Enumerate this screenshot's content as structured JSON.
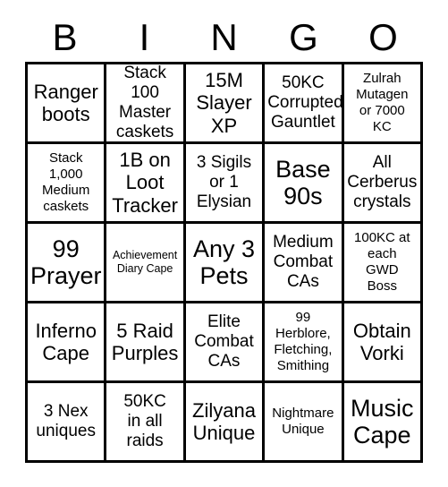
{
  "card": {
    "title_letters": [
      "B",
      "I",
      "N",
      "G",
      "O"
    ],
    "columns": 5,
    "rows": 5,
    "grid_line_color": "#000000",
    "background_color": "#ffffff",
    "text_color": "#000000",
    "cells": [
      {
        "text": "Ranger\nboots",
        "size": "lg"
      },
      {
        "text": "Stack 100\nMaster\ncaskets",
        "size": "md"
      },
      {
        "text": "15M\nSlayer\nXP",
        "size": "lg"
      },
      {
        "text": "50KC\nCorrupted\nGauntlet",
        "size": "md"
      },
      {
        "text": "Zulrah\nMutagen\nor 7000\nKC",
        "size": "sm"
      },
      {
        "text": "Stack\n1,000\nMedium\ncaskets",
        "size": "sm"
      },
      {
        "text": "1B on\nLoot\nTracker",
        "size": "lg"
      },
      {
        "text": "3 Sigils\nor 1\nElysian",
        "size": "md"
      },
      {
        "text": "Base\n90s",
        "size": "xl"
      },
      {
        "text": "All\nCerberus\ncrystals",
        "size": "md"
      },
      {
        "text": "99\nPrayer",
        "size": "xl"
      },
      {
        "text": "Achievement\nDiary Cape",
        "size": "xs"
      },
      {
        "text": "Any 3\nPets",
        "size": "xl"
      },
      {
        "text": "Medium\nCombat\nCAs",
        "size": "md"
      },
      {
        "text": "100KC at\neach\nGWD\nBoss",
        "size": "sm"
      },
      {
        "text": "Inferno\nCape",
        "size": "lg"
      },
      {
        "text": "5 Raid\nPurples",
        "size": "lg"
      },
      {
        "text": "Elite\nCombat\nCAs",
        "size": "md"
      },
      {
        "text": "99\nHerblore,\nFletching,\nSmithing",
        "size": "sm"
      },
      {
        "text": "Obtain\nVorki",
        "size": "lg"
      },
      {
        "text": "3 Nex\nuniques",
        "size": "md"
      },
      {
        "text": "50KC\nin all\nraids",
        "size": "md"
      },
      {
        "text": "Zilyana\nUnique",
        "size": "lg"
      },
      {
        "text": "Nightmare\nUnique",
        "size": "sm"
      },
      {
        "text": "Music\nCape",
        "size": "xl"
      }
    ]
  }
}
